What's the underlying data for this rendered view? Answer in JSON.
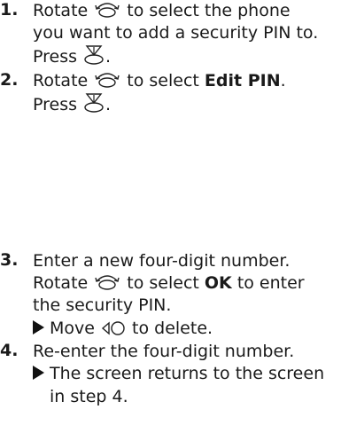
{
  "steps": [
    {
      "num": "1.",
      "lines": [
        {
          "a": "Rotate ",
          "b": " to select the phone"
        },
        {
          "a": "you want to add a security PIN to."
        },
        {
          "a": "Press ",
          "b": "."
        }
      ]
    },
    {
      "num": "2.",
      "lines": [
        {
          "a": "Rotate ",
          "b": " to select ",
          "bold": "Edit PIN",
          "c": "."
        },
        {
          "a": "Press ",
          "b": "."
        }
      ]
    },
    {
      "num": "3.",
      "lines": [
        {
          "a": "Enter a new four-digit number."
        },
        {
          "a": "Rotate ",
          "b": " to select ",
          "bold": "OK",
          "c": " to enter"
        },
        {
          "a": "the security PIN."
        },
        {
          "a": "Move ",
          "b": " to delete."
        }
      ]
    },
    {
      "num": "4.",
      "lines": [
        {
          "a": "Re-enter the four-digit number."
        },
        {
          "a": "The screen returns to the screen"
        },
        {
          "a": "in step 4."
        }
      ]
    }
  ],
  "icons": {
    "rotate": "interface-dial-rotate-icon",
    "press": "interface-dial-press-icon",
    "move": "interface-dial-move-left-icon",
    "bullet": "triangle-bullet-icon"
  }
}
